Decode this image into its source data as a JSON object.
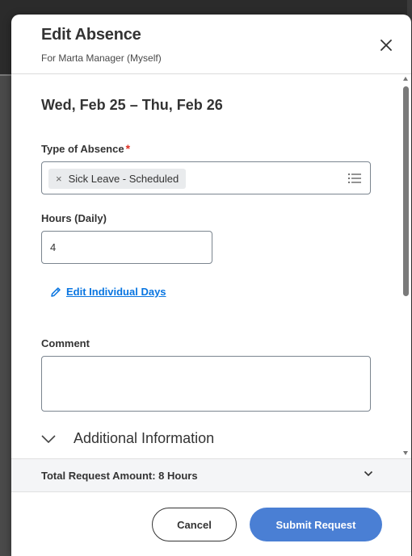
{
  "dialog": {
    "title": "Edit Absence",
    "subtitle": "For Marta Manager (Myself)"
  },
  "form": {
    "date_range": "Wed, Feb 25 – Thu, Feb 26",
    "absence_type": {
      "label": "Type of Absence",
      "required_mark": "*",
      "selected_value": "Sick Leave - Scheduled",
      "remove_glyph": "×"
    },
    "hours": {
      "label": "Hours (Daily)",
      "value": "4"
    },
    "edit_days_link": "Edit Individual Days",
    "comment": {
      "label": "Comment",
      "value": ""
    },
    "additional_info": "Additional Information"
  },
  "summary": {
    "total_text": "Total Request Amount: 8 Hours"
  },
  "footer": {
    "cancel_label": "Cancel",
    "submit_label": "Submit Request"
  },
  "icons": {
    "close": "close-icon",
    "list": "list-icon",
    "pencil": "pencil-icon",
    "expand": "chevron-down-icon"
  },
  "colors": {
    "primary_button": "#4a7fd4",
    "link": "#0875e1",
    "required": "#de2e21"
  }
}
